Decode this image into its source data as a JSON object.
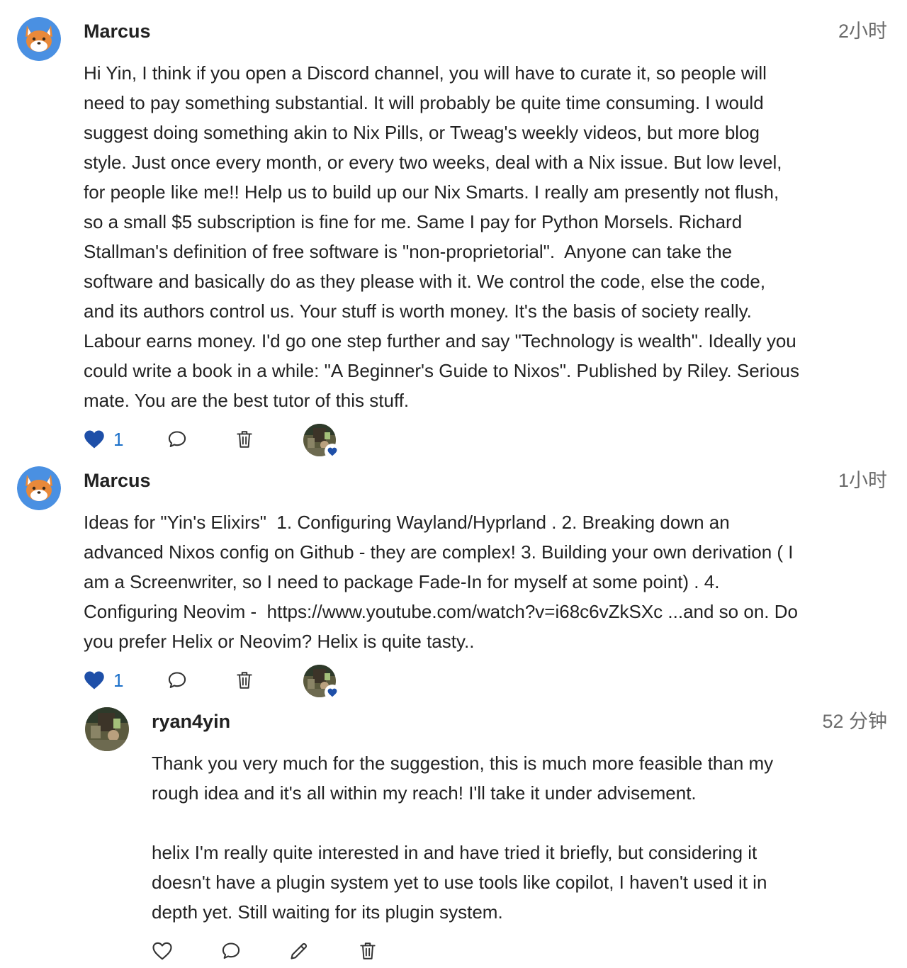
{
  "comments": [
    {
      "author": "Marcus",
      "time": "2小时",
      "avatar_icon": "fox-avatar-icon",
      "body": "Hi Yin, I think if you open a Discord channel, you will have to curate it, so people will\nneed to pay something substantial. It will probably be quite time consuming. I would\nsuggest doing something akin to Nix Pills, or Tweag's weekly videos, but more blog\nstyle. Just once every month, or every two weeks, deal with a Nix issue. But low level,\nfor people like me!! Help us to build up our Nix Smarts. I really am presently not flush,\nso a small $5 subscription is fine for me. Same I pay for Python Morsels. Richard\nStallman's definition of free software is \"non-proprietorial\".  Anyone can take the\nsoftware and basically do as they please with it. We control the code, else the code,\nand its authors control us. Your stuff is worth money. It's the basis of society really.\nLabour earns money. I'd go one step further and say \"Technology is wealth\". Ideally you\ncould write a book in a while: \"A Beginner's Guide to Nixos\". Published by Riley. Serious\nmate. You are the best tutor of this stuff.",
      "like_count": "1",
      "liked": true
    },
    {
      "author": "Marcus",
      "time": "1小时",
      "avatar_icon": "fox-avatar-icon",
      "body": "Ideas for \"Yin's Elixirs\"  1. Configuring Wayland/Hyprland . 2. Breaking down an\nadvanced Nixos config on Github - they are complex! 3. Building your own derivation ( I\nam a Screenwriter, so I need to package Fade-In for myself at some point) . 4.\nConfiguring Neovim -  https://www.youtube.com/watch?v=i68c6vZkSXc ...and so on. Do\nyou prefer Helix or Neovim? Helix is quite tasty..",
      "like_count": "1",
      "liked": true
    },
    {
      "author": "ryan4yin",
      "time": "52 分钟",
      "avatar_icon": "photo-avatar-icon",
      "body": "Thank you very much for the suggestion, this is much more feasible than my\nrough idea and it's all within my reach! I'll take it under advisement.\n\nhelix I'm really quite interested in and have tried it briefly, but considering it\ndoesn't have a plugin system yet to use tools like copilot, I haven't used it in\ndepth yet. Still waiting for its plugin system.",
      "liked": false
    }
  ],
  "colors": {
    "accent_blue": "#1a6fc9",
    "heart_filled": "#1e4fa8",
    "avatar_bg": "#4a90e2",
    "fox_orange": "#e8893a",
    "text": "#222222",
    "muted": "#6b6b6b"
  }
}
